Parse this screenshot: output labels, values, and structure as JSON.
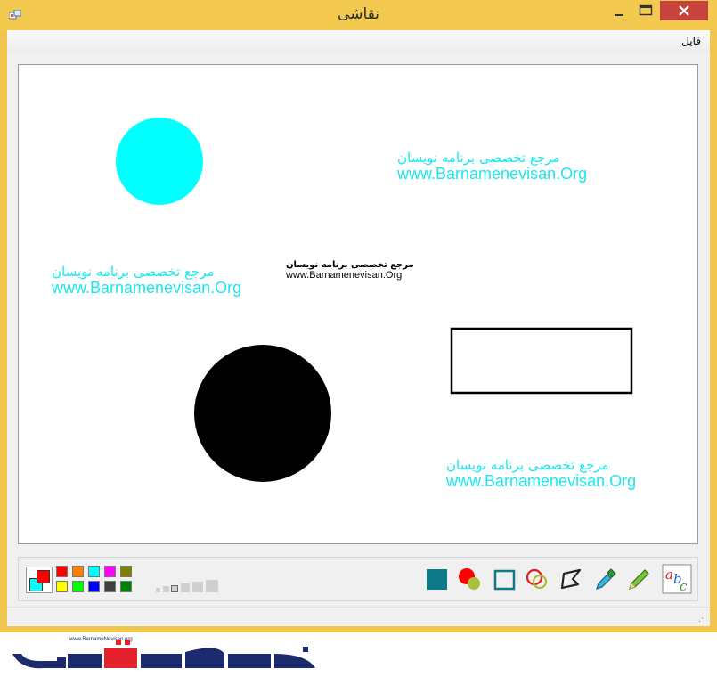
{
  "window": {
    "title": "نقاشی",
    "accent_color": "#f3c94f",
    "close_color": "#c7433b"
  },
  "menubar": {
    "file_label": "فایل"
  },
  "canvas": {
    "watermark_fa": "مرجع تخصصی برنامه نویسان",
    "watermark_en": "www.Barnamenevisan.Org",
    "watermark_color": "#1ce6ee",
    "small_text_fa": "مرجع تخصصی برنامه نویسان",
    "small_text_en": "www.Barnamenevisan.Org",
    "shapes": [
      {
        "type": "filled-ellipse",
        "color": "#00ffff"
      },
      {
        "type": "filled-ellipse",
        "color": "#000000"
      },
      {
        "type": "rectangle-outline",
        "color": "#000000"
      }
    ]
  },
  "toolbar": {
    "primary_color": "#ff0000",
    "secondary_color": "#00ffff",
    "palette": [
      "#ff0000",
      "#ff8000",
      "#00ffff",
      "#ff00ff",
      "#808000",
      "#ffff00",
      "#00ff00",
      "#0000ff",
      "#404040",
      "#008000"
    ],
    "tools": [
      "filled-rectangle-tool",
      "filled-ellipse-tool",
      "rectangle-tool",
      "ellipse-tool",
      "polygon-tool",
      "eyedropper-tool",
      "pencil-tool",
      "text-tool"
    ]
  },
  "footer_logo": {
    "small_text": "www.BarnameNevisan.org",
    "logo_text": "برنامه نویسان"
  }
}
